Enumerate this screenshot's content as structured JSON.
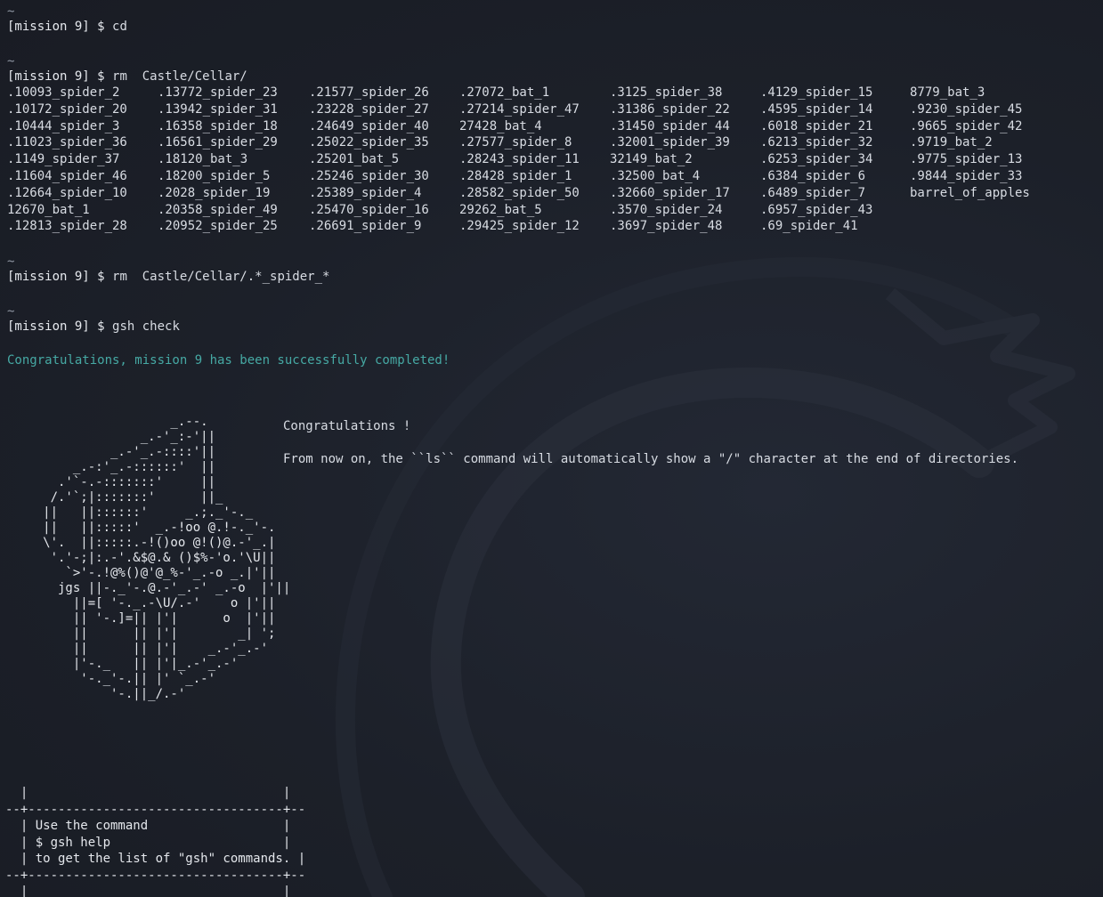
{
  "terminal": {
    "tilde": "~",
    "prompt": "[mission 9] $",
    "commands": [
      "cd",
      "rm  Castle/Cellar/",
      "rm  Castle/Cellar/.*_spider_*",
      "gsh check"
    ],
    "ls_columns": [
      [
        ".10093_spider_2",
        ".10172_spider_20",
        ".10444_spider_3",
        ".11023_spider_36",
        ".1149_spider_37",
        ".11604_spider_46",
        ".12664_spider_10",
        "12670_bat_1",
        ".12813_spider_28"
      ],
      [
        ".13772_spider_23",
        ".13942_spider_31",
        ".16358_spider_18",
        ".16561_spider_29",
        ".18120_bat_3",
        ".18200_spider_5",
        ".2028_spider_19",
        ".20358_spider_49",
        ".20952_spider_25"
      ],
      [
        ".21577_spider_26",
        ".23228_spider_27",
        ".24649_spider_40",
        ".25022_spider_35",
        ".25201_bat_5",
        ".25246_spider_30",
        ".25389_spider_4",
        ".25470_spider_16",
        ".26691_spider_9"
      ],
      [
        ".27072_bat_1",
        ".27214_spider_47",
        "27428_bat_4",
        ".27577_spider_8",
        ".28243_spider_11",
        ".28428_spider_1",
        ".28582_spider_50",
        "29262_bat_5",
        ".29425_spider_12"
      ],
      [
        ".3125_spider_38",
        ".31386_spider_22",
        ".31450_spider_44",
        ".32001_spider_39",
        "32149_bat_2",
        ".32500_bat_4",
        ".32660_spider_17",
        ".3570_spider_24",
        ".3697_spider_48"
      ],
      [
        ".4129_spider_15",
        ".4595_spider_14",
        ".6018_spider_21",
        ".6213_spider_32",
        ".6253_spider_34",
        ".6384_spider_6",
        ".6489_spider_7",
        ".6957_spider_43",
        ".69_spider_41"
      ],
      [
        "8779_bat_3",
        ".9230_spider_45",
        ".9665_spider_42",
        ".9719_bat_2",
        ".9775_spider_13",
        ".9844_spider_33",
        "barrel_of_apples"
      ]
    ],
    "success_message": "Congratulations, mission 9 has been successfully completed!",
    "ascii_art": "                      _.--.\n                  _.-'_:-'||\n              _.-'_.-::::'||\n         _.-:'_.-::::::'  ||\n       .'`-.-:::::::'     ||\n      /.'`;|:::::::'      ||_\n     ||   ||::::::'     _.;._'-._\n     ||   ||:::::'  _.-!oo @.!-._'-.\n     \\'.  ||:::::.-!()oo @!()@.-'_.|\n      '.'-;|:.-'.&$@.& ()$%-'o.'\\U||\n        `>'-.!@%()@'@_%-'_.-o _.|'||\n       jgs ||-._'-.@.-'_.-' _.-o  |'||\n         ||=[ '-._.-\\U/.-'    o |'||\n         || '-.]=|| |'|      o  |'||\n         ||      || |'|        _| ';\n         ||      || |'|    _.-'_.-'\n         |'-._   || |'|_.-'_.-'\n          '-._'-.|| |' `_.-'\n              '-.||_/.-'",
    "congrats_title": "Congratulations !",
    "congrats_message": "From now on, the ``ls`` command will automatically show a \"/\" character at the end of directories.",
    "help_box": "  |                                  |\n--+----------------------------------+--\n  | Use the command                  |\n  | $ gsh help                       |\n  | to get the list of \"gsh\" commands. |\n--+----------------------------------+--\n  |                                  |"
  }
}
